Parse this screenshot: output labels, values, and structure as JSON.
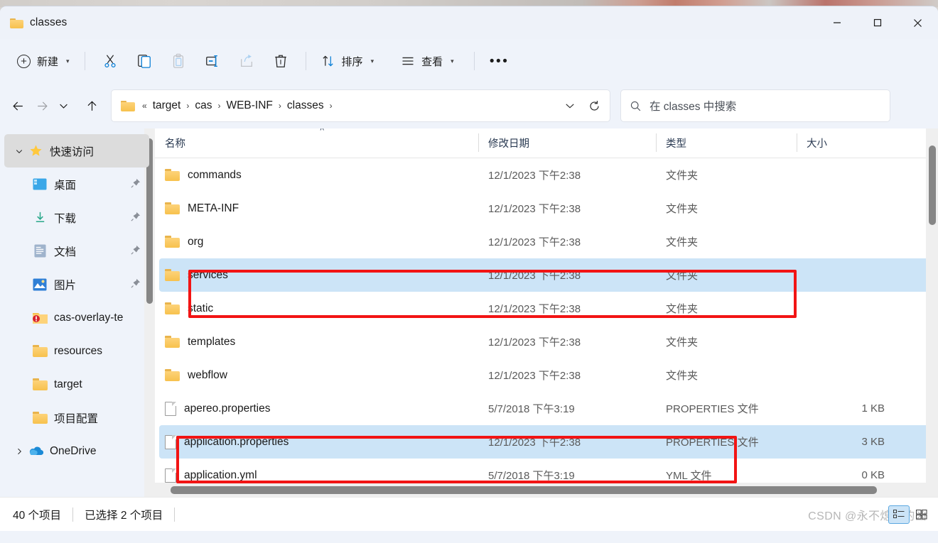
{
  "window": {
    "title": "classes",
    "folder_icon": "folder-icon",
    "controls": {
      "minimize": "minimize-button",
      "maximize": "maximize-button",
      "close": "close-button"
    }
  },
  "toolbar": {
    "new_label": "新建",
    "cut_label": "剪切",
    "copy_label": "复制",
    "paste_label": "粘贴",
    "rename_label": "重命名",
    "share_label": "共享",
    "delete_label": "删除",
    "sort_label": "排序",
    "view_label": "查看",
    "more_label": "•••"
  },
  "addressbar": {
    "back": "back-button",
    "forward": "forward-button",
    "recent": "recent-locations-button",
    "up": "up-button",
    "prefix": "«",
    "crumbs": [
      "target",
      "cas",
      "WEB-INF",
      "classes"
    ],
    "separator": "›",
    "dropdown": "previous-locations-chevron",
    "refresh": "refresh-button"
  },
  "search": {
    "placeholder": "在 classes 中搜索",
    "icon": "search-icon"
  },
  "sidebar": {
    "items": [
      {
        "label": "快速访问",
        "icon": "star-icon",
        "expander": "⌄",
        "selected": true,
        "pinned": false,
        "child": false
      },
      {
        "label": "桌面",
        "icon": "desktop-icon",
        "pinned": true,
        "child": true
      },
      {
        "label": "下载",
        "icon": "downloads-icon",
        "pinned": true,
        "child": true
      },
      {
        "label": "文档",
        "icon": "documents-icon",
        "pinned": true,
        "child": true
      },
      {
        "label": "图片",
        "icon": "pictures-icon",
        "pinned": true,
        "child": true
      },
      {
        "label": "cas-overlay-te",
        "icon": "folder-warning-icon",
        "pinned": false,
        "child": true
      },
      {
        "label": "resources",
        "icon": "folder-icon",
        "pinned": false,
        "child": true
      },
      {
        "label": "target",
        "icon": "folder-icon",
        "pinned": false,
        "child": true
      },
      {
        "label": "项目配置",
        "icon": "folder-icon",
        "pinned": false,
        "child": true
      },
      {
        "label": "OneDrive",
        "icon": "onedrive-icon",
        "expander": "›",
        "pinned": false,
        "child": false
      }
    ]
  },
  "filelist": {
    "columns": [
      {
        "label": "名称",
        "sorted": "asc"
      },
      {
        "label": "修改日期"
      },
      {
        "label": "类型"
      },
      {
        "label": "大小"
      }
    ],
    "sort_caret": "˄",
    "rows": [
      {
        "name": "commands",
        "date": "12/1/2023 下午2:38",
        "type": "文件夹",
        "size": "",
        "icon": "folder-icon",
        "selected": false
      },
      {
        "name": "META-INF",
        "date": "12/1/2023 下午2:38",
        "type": "文件夹",
        "size": "",
        "icon": "folder-icon",
        "selected": false
      },
      {
        "name": "org",
        "date": "12/1/2023 下午2:38",
        "type": "文件夹",
        "size": "",
        "icon": "folder-icon",
        "selected": false
      },
      {
        "name": "services",
        "date": "12/1/2023 下午2:38",
        "type": "文件夹",
        "size": "",
        "icon": "folder-icon",
        "selected": true
      },
      {
        "name": "static",
        "date": "12/1/2023 下午2:38",
        "type": "文件夹",
        "size": "",
        "icon": "folder-icon",
        "selected": false
      },
      {
        "name": "templates",
        "date": "12/1/2023 下午2:38",
        "type": "文件夹",
        "size": "",
        "icon": "folder-icon",
        "selected": false
      },
      {
        "name": "webflow",
        "date": "12/1/2023 下午2:38",
        "type": "文件夹",
        "size": "",
        "icon": "folder-icon",
        "selected": false
      },
      {
        "name": "apereo.properties",
        "date": "5/7/2018 下午3:19",
        "type": "PROPERTIES 文件",
        "size": "1 KB",
        "icon": "document-icon",
        "selected": false
      },
      {
        "name": "application.properties",
        "date": "12/1/2023 下午2:38",
        "type": "PROPERTIES 文件",
        "size": "3 KB",
        "icon": "document-icon",
        "selected": true
      },
      {
        "name": "application.yml",
        "date": "5/7/2018 下午3:19",
        "type": "YML 文件",
        "size": "0 KB",
        "icon": "document-icon",
        "selected": false
      }
    ]
  },
  "statusbar": {
    "item_count": "40 个项目",
    "selection": "已选择 2 个项目",
    "watermark": "CSDN @永不熄灭的凶",
    "view_details": "details-view-button",
    "view_large": "large-icons-view-button"
  },
  "annotations": {
    "color": "#f21414",
    "box1_target": "services",
    "box2_target": "application.properties"
  },
  "colors": {
    "selection": "#cce4f7",
    "chrome": "#eff3fa",
    "accent_red": "#f21414"
  }
}
